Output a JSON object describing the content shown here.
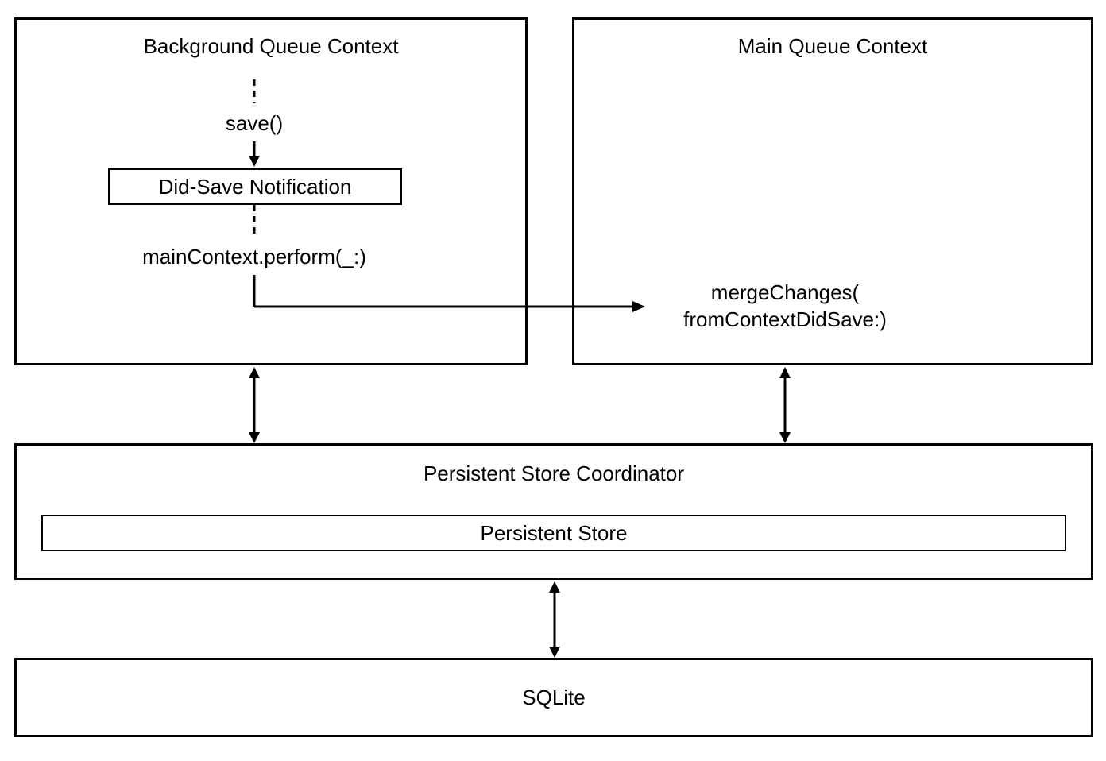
{
  "boxes": {
    "background_queue": {
      "title": "Background Queue Context",
      "save_label": "save()",
      "notification": "Did-Save Notification",
      "perform_label": "mainContext.perform(_:)"
    },
    "main_queue": {
      "title": "Main Queue Context",
      "merge_line1": "mergeChanges(",
      "merge_line2": "fromContextDidSave:)"
    },
    "coordinator": {
      "title": "Persistent Store Coordinator",
      "store": "Persistent Store"
    },
    "sqlite": {
      "title": "SQLite"
    }
  }
}
